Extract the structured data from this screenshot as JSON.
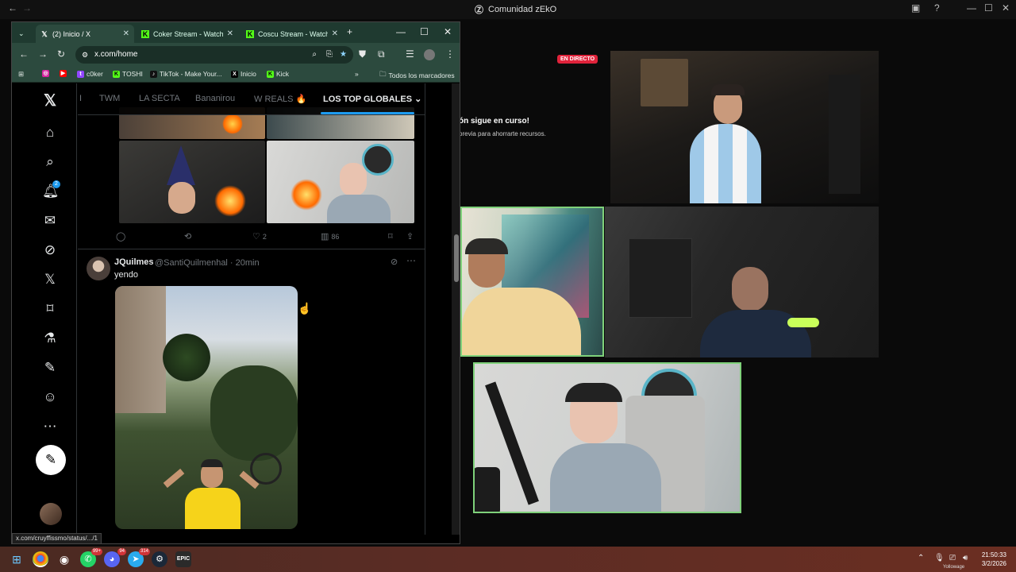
{
  "bg_app": {
    "title": "Comunidad zEkO",
    "live_badge": "EN DIRECTO",
    "notice_title": "ón sigue en curso!",
    "notice_sub": "previa para ahorrarte recursos."
  },
  "browser": {
    "tabs": [
      {
        "label": "(2) Inicio / X",
        "icon": "x-logo-icon",
        "active": true
      },
      {
        "label": "Coker Stream - Watch L",
        "icon": "kick-icon",
        "active": false
      },
      {
        "label": "Coscu Stream - Watch L",
        "icon": "kick-icon",
        "active": false
      }
    ],
    "url": "x.com/home",
    "bookmarks": [
      {
        "label": "c0ker",
        "color": "#53fc18"
      },
      {
        "label": "TOSHI",
        "color": "#53fc18"
      },
      {
        "label": "TikTok - Make Your...",
        "color": "#111"
      },
      {
        "label": "Inicio",
        "color": "#000"
      },
      {
        "label": "Kick",
        "color": "#53fc18"
      }
    ],
    "all_bookmarks": "Todos los marcadores",
    "status_url": "x.com/cruyffissmo/status/.../1"
  },
  "x": {
    "notif_count": "2",
    "feed_tabs": [
      "I",
      "TWM",
      "LA SECTA",
      "Bananirou",
      "W REALS 🔥",
      "LOS TOP GLOBALES"
    ],
    "tweet1": {
      "likes": "2",
      "views": "86"
    },
    "tweet2": {
      "name": "JQuilmes",
      "handle": "@SantiQuilmenhal · 20min",
      "text": "yendo"
    }
  },
  "taskbar": {
    "time": "21:50:33",
    "date": "3/2/2026",
    "whatsapp_badge": "99+",
    "discord_badge": "94",
    "telegram_badge": "314",
    "tray_label": "Yollowage"
  }
}
